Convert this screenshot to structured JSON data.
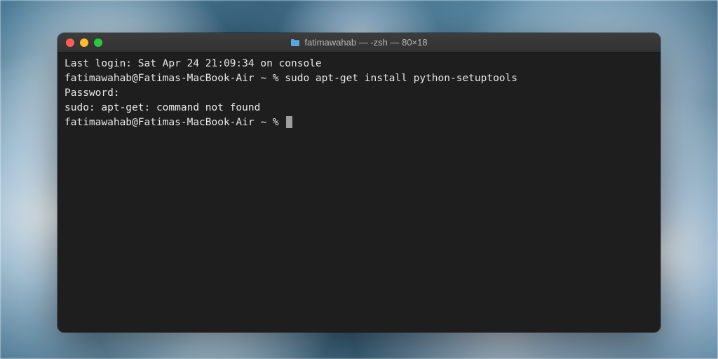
{
  "window": {
    "title": "fatimawahab — -zsh — 80×18"
  },
  "terminal": {
    "lines": [
      "Last login: Sat Apr 24 21:09:34 on console",
      "fatimawahab@Fatimas-MacBook-Air ~ % sudo apt-get install python-setuptools",
      "Password:",
      "sudo: apt-get: command not found",
      "fatimawahab@Fatimas-MacBook-Air ~ % "
    ]
  }
}
